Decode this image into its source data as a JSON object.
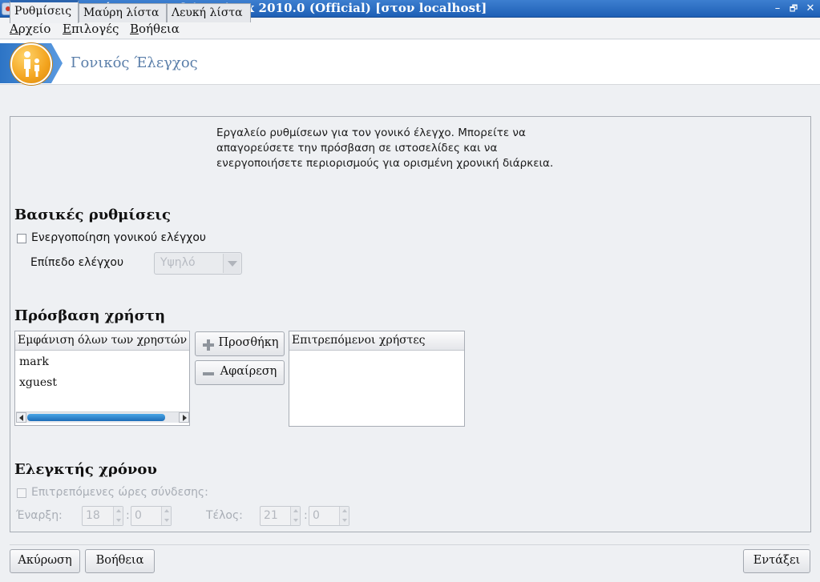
{
  "window": {
    "title": "Κέντρο Ελέγχου Mandriva Linux 2010.0 (Official) [στον localhost]",
    "minimize_glyph": "–",
    "maximize_glyph": "🗗",
    "close_glyph": "✕"
  },
  "menubar": {
    "items": [
      "Αρχείο",
      "Επιλογές",
      "Βοήθεια"
    ]
  },
  "header": {
    "title": "Γονικός Έλεγχος",
    "icon": "parental-control-icon",
    "accent_color": "#2d74c5"
  },
  "tabs": [
    "Ρυθμίσεις",
    "Μαύρη λίστα",
    "Λευκή λίστα"
  ],
  "active_tab": "Ρυθμίσεις",
  "description": {
    "lines": [
      "Εργαλείο ρυθμίσεων για τον γονικό έλεγχο. Μπορείτε να",
      "απαγορεύσετε την πρόσβαση σε ιστοσελίδες και να",
      "ενεργοποιήσετε περιορισμούς για ορισμένη χρονική διάρκεια."
    ]
  },
  "basic": {
    "heading": "Βασικές ρυθμίσεις",
    "enable_label": "Ενεργοποίηση γονικού ελέγχου",
    "enabled": false,
    "level_label": "Επίπεδο ελέγχου",
    "level_value": "Υψηλό"
  },
  "access": {
    "heading": "Πρόσβαση χρήστη",
    "all_users_header": "Εμφάνιση όλων των χρηστών",
    "users": [
      "mark",
      "xguest"
    ],
    "add_label": "Προσθήκη",
    "remove_label": "Αφαίρεση",
    "allowed_header": "Επιτρεπόμενοι χρήστες",
    "allowed_users": []
  },
  "timer": {
    "heading": "Ελεγκτής χρόνου",
    "allowed_hours_label": "Επιτρεπόμενες ώρες σύνδεσης:",
    "allowed_hours_enabled": false,
    "start_label": "Έναρξη:",
    "start_hour": "18",
    "start_minute": "0",
    "end_label": "Τέλος:",
    "end_hour": "21",
    "end_minute": "0",
    "colon": ":"
  },
  "footer": {
    "cancel_label": "Ακύρωση",
    "help_label": "Βοήθεια",
    "ok_label": "Εντάξει"
  }
}
